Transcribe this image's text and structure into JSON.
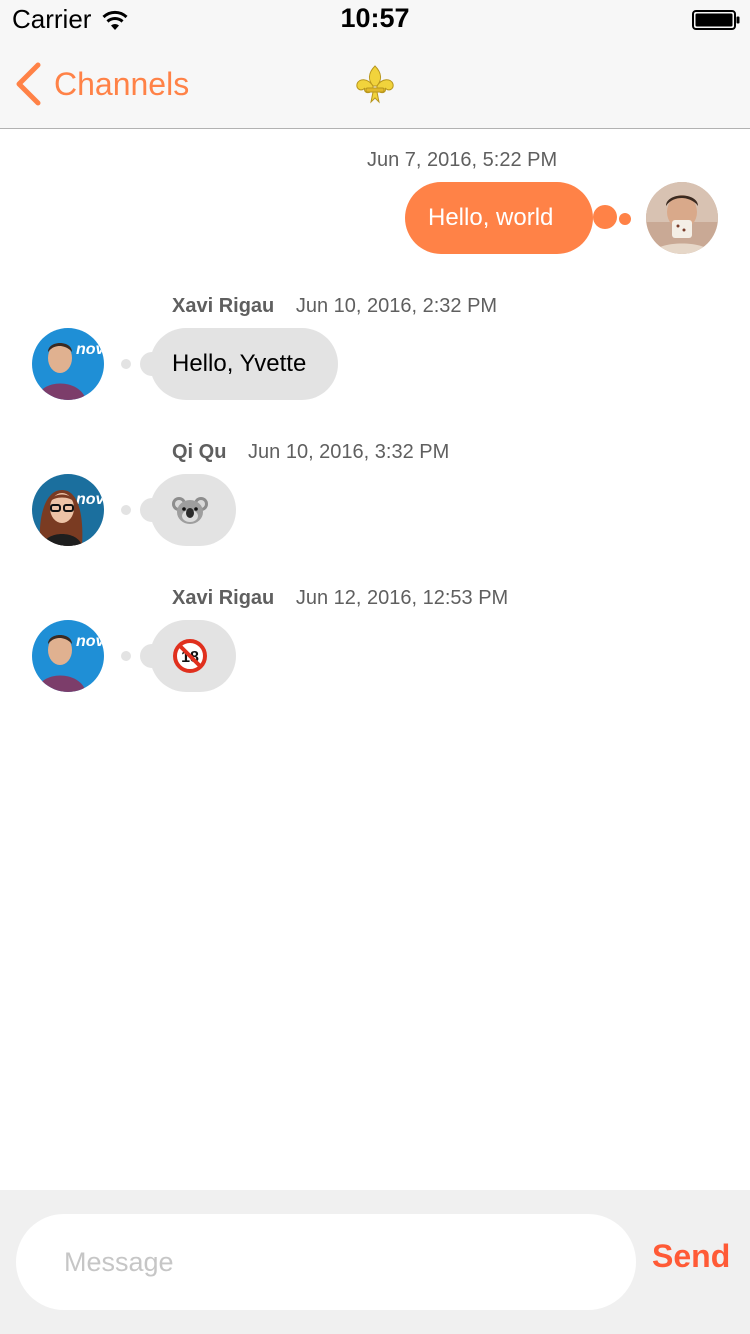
{
  "status_bar": {
    "carrier": "Carrier",
    "time": "10:57",
    "icons": [
      "wifi-icon",
      "battery-icon"
    ]
  },
  "nav": {
    "back_label": "Channels",
    "back_icon": "chevron-left-icon",
    "title_icon": "fleur-de-lis-icon",
    "accent_color": "#ff8247"
  },
  "messages": [
    {
      "direction": "outgoing",
      "sender": "",
      "timestamp": "Jun 7, 2016, 5:22 PM",
      "text": "Hello, world",
      "avatar": "user-avatar-self"
    },
    {
      "direction": "incoming",
      "sender": "Xavi Rigau",
      "timestamp": "Jun 10, 2016, 2:32 PM",
      "text": "Hello, Yvette",
      "avatar": "avatar-xavi-rigau"
    },
    {
      "direction": "incoming",
      "sender": "Qi Qu",
      "timestamp": "Jun 10, 2016, 3:32 PM",
      "text": "",
      "emoji": "koala-emoji",
      "avatar": "avatar-qi-qu"
    },
    {
      "direction": "incoming",
      "sender": "Xavi Rigau",
      "timestamp": "Jun 12, 2016, 12:53 PM",
      "text": "",
      "emoji": "no-one-under-eighteen-emoji",
      "avatar": "avatar-xavi-rigau"
    }
  ],
  "composer": {
    "placeholder": "Message",
    "value": "",
    "send_label": "Send",
    "send_color": "#ff5a36"
  },
  "colors": {
    "outgoing_bubble": "#ff8247",
    "incoming_bubble": "#e3e3e3",
    "nav_background": "#f7f7f7"
  }
}
